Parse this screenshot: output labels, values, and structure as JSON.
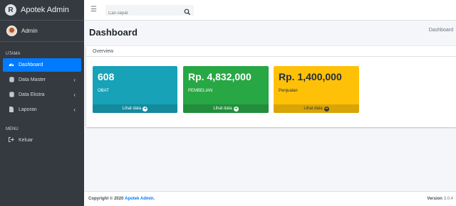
{
  "brand": {
    "name": "Apotek Admin",
    "logo_letter": "R"
  },
  "user": {
    "name": "Admin"
  },
  "sidebar": {
    "header_main": "UTAMA",
    "items": [
      {
        "label": "Dashboard",
        "icon": "dashboard-icon"
      },
      {
        "label": "Data Master",
        "icon": "database-icon"
      },
      {
        "label": "Data Ekstra",
        "icon": "database-icon"
      },
      {
        "label": "Laporan",
        "icon": "file-icon"
      }
    ],
    "header_menu": "MENU",
    "logout": {
      "label": "Keluar",
      "icon": "sign-out-icon"
    }
  },
  "topbar": {
    "search_placeholder": "Cari cepat"
  },
  "page": {
    "title": "Dashboard",
    "breadcrumb": "Dashboard"
  },
  "card": {
    "title": "Overview"
  },
  "stats": [
    {
      "value": "608",
      "label": "OBAT",
      "footer": "Lihat data",
      "color": "#17a2b8"
    },
    {
      "value": "Rp. 4,832,000",
      "label": "PEMBELIAN",
      "footer": "Lihat data",
      "color": "#28a745"
    },
    {
      "value": "Rp. 1,400,000",
      "label": "Penjualan",
      "footer": "Lihat data",
      "color": "#ffc107"
    }
  ],
  "footer": {
    "copyright": "Copyright © 2020",
    "brand_link": "Apotek Admin.",
    "version_label": "Version",
    "version_number": "3.0.4"
  }
}
